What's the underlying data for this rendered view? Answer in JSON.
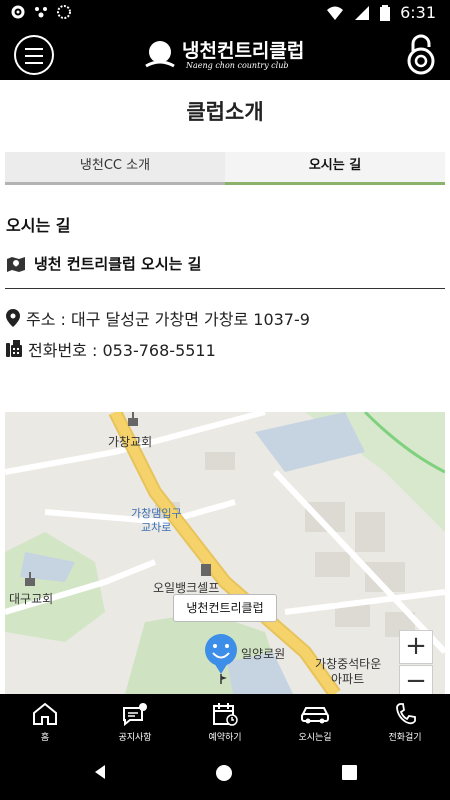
{
  "status_bar": {
    "time": "6:31"
  },
  "header": {
    "logo_title": "냉천컨트리클럽",
    "logo_subtitle": "Naeng chon country club"
  },
  "page": {
    "title": "클럽소개",
    "tabs": [
      {
        "label": "냉천CC 소개",
        "active": false
      },
      {
        "label": "오시는 길",
        "active": true
      }
    ],
    "section_heading": "오시는 길",
    "sub_heading": "냉천 컨트리클럽 오시는 길",
    "address": "주소 : 대구 달성군 가창면 가창로 1037-9",
    "phone": "전화번호 : 053-768-5511"
  },
  "map": {
    "labels": {
      "church1": "가창교회",
      "intersection_l1": "가창댐입구",
      "intersection_l2": "교차로",
      "gas": "오일뱅크셀프",
      "church2": "대구교회",
      "nursing": "일양로원",
      "apt_l1": "가창중석타운",
      "apt_l2": "아파트"
    },
    "callout": "냉천컨트리클럽",
    "zoom_in": "+",
    "zoom_out": "−"
  },
  "bottom_nav": [
    {
      "label": "홈",
      "icon": "home-icon"
    },
    {
      "label": "공지사항",
      "icon": "notice-icon"
    },
    {
      "label": "예약하기",
      "icon": "calendar-icon"
    },
    {
      "label": "오시는길",
      "icon": "car-icon"
    },
    {
      "label": "전화걸기",
      "icon": "phone-icon"
    }
  ],
  "colors": {
    "accent": "#8ab26b",
    "bar": "#000000",
    "pin": "#3d8ee8",
    "road": "#f6d36a"
  }
}
